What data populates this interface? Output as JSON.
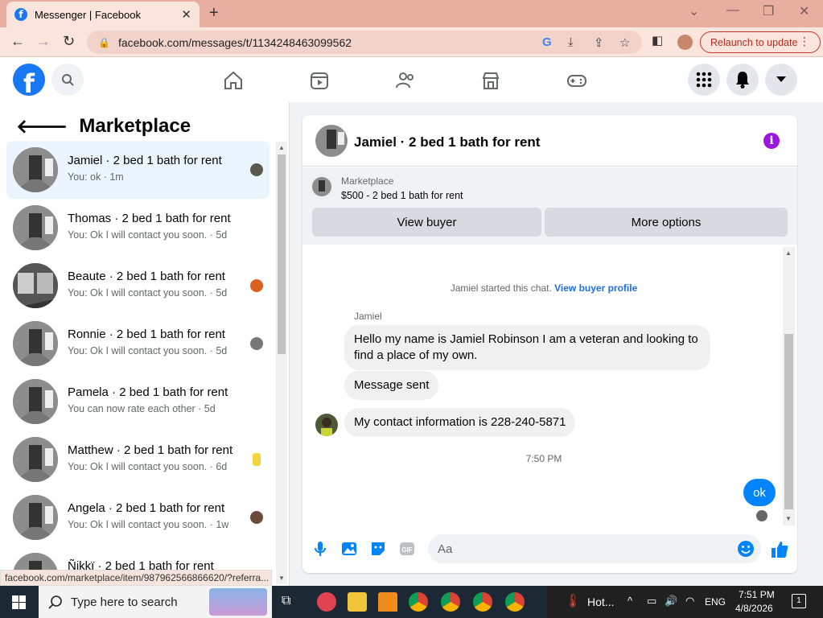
{
  "browser": {
    "tab_title": "Messenger | Facebook",
    "url": "facebook.com/messages/t/1134248463099562",
    "relaunch_label": "Relaunch to update"
  },
  "left_panel": {
    "title": "Marketplace",
    "conversations": [
      {
        "name": "Jamiel · 2 bed 1 bath for rent",
        "sub": "You: ok · 1m"
      },
      {
        "name": "Thomas · 2 bed 1 bath for rent",
        "sub": "You: Ok I will contact you soon. · 5d"
      },
      {
        "name": "Beaute · 2 bed 1 bath for rent",
        "sub": "You: Ok I will contact you soon. · 5d"
      },
      {
        "name": "Ronnie · 2 bed 1 bath for rent",
        "sub": "You: Ok I will contact you soon. · 5d"
      },
      {
        "name": "Pamela · 2 bed 1 bath for rent",
        "sub": "You can now rate each other · 5d"
      },
      {
        "name": "Matthew · 2 bed 1 bath for rent",
        "sub": "You: Ok I will contact you soon. · 6d"
      },
      {
        "name": "Angela · 2 bed 1 bath for rent",
        "sub": "You: Ok I will contact you soon. · 1w"
      },
      {
        "name": "Ñikkï · 2 bed 1 bath for rent",
        "sub": ""
      }
    ]
  },
  "status_url": "facebook.com/marketplace/item/987962566866620/?referra...",
  "chat": {
    "title": "Jamiel · 2 bed 1 bath for rent",
    "marketplace_label": "Marketplace",
    "listing": "$500 - 2 bed 1 bath for rent",
    "view_buyer": "View buyer",
    "more_options": "More options",
    "system_msg": "Jamiel started this chat.",
    "system_link": "View buyer profile",
    "sender": "Jamiel",
    "messages": [
      "Hello my name is Jamiel Robinson I am a veteran and looking to find a place of my own.",
      "Message sent",
      "My contact information is 228-240-5871"
    ],
    "time": "7:50 PM",
    "my_message": "ok",
    "composer_placeholder": "Aa"
  },
  "taskbar": {
    "search_placeholder": "Type here to search",
    "weather": "Hot...",
    "lang": "ENG",
    "time": "7:51 PM",
    "date": "4/8/2026",
    "notif_count": "1"
  },
  "colors": {
    "brand": "#1877f2",
    "my_bubble": "#0084ff",
    "info": "#9a16e0"
  }
}
